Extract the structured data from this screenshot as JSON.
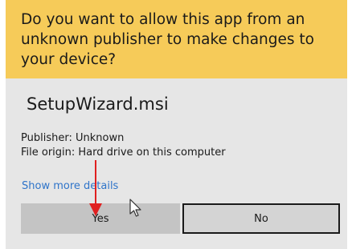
{
  "dialog": {
    "question": "Do you want to allow this app from an unknown publisher to make changes to your device?",
    "app_name": "SetupWizard.msi",
    "publisher": "Publisher: Unknown",
    "file_origin": "File origin: Hard drive on this computer",
    "show_more_label": "Show more details",
    "yes_label": "Yes",
    "no_label": "No"
  },
  "colors": {
    "header_background": "#f6cb59",
    "body_background": "#e6e6e6",
    "link": "#2f74c9",
    "annotation_arrow": "#e02020"
  },
  "icons": {
    "annotation": "red-arrow-icon",
    "cursor": "mouse-pointer-icon"
  }
}
